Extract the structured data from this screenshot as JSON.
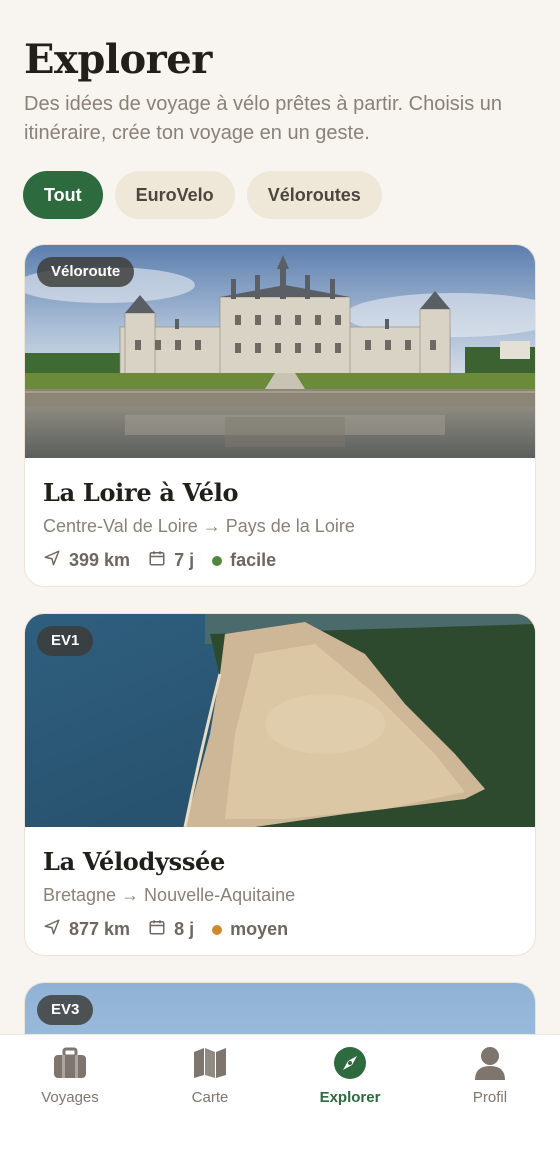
{
  "header": {
    "title": "Explorer",
    "subtitle": "Des idées de voyage à vélo prêtes à partir. Choisis un itinéraire, crée ton voyage en un geste."
  },
  "filters": [
    {
      "label": "Tout",
      "active": true
    },
    {
      "label": "EuroVelo",
      "active": false
    },
    {
      "label": "Véloroutes",
      "active": false
    }
  ],
  "routes": [
    {
      "badge": "Véloroute",
      "title": "La Loire à Vélo",
      "route": "Centre-Val de Loire → Pays de la Loire",
      "distance": "399 km",
      "duration": "7 j",
      "difficulty": "facile",
      "difficulty_color": "#4f8a3a",
      "image": "chateau-chambord-photo"
    },
    {
      "badge": "EV1",
      "title": "La Vélodyssée",
      "route": "Bretagne → Nouvelle-Aquitaine",
      "distance": "877 km",
      "duration": "8 j",
      "difficulty": "moyen",
      "difficulty_color": "#d08a2e",
      "image": "dune-du-pilat-photo"
    },
    {
      "badge": "EV3",
      "image": "sky-photo"
    }
  ],
  "tabs": [
    {
      "label": "Voyages",
      "icon": "briefcase-icon",
      "active": false
    },
    {
      "label": "Carte",
      "icon": "map-icon",
      "active": false
    },
    {
      "label": "Explorer",
      "icon": "compass-icon",
      "active": true
    },
    {
      "label": "Profil",
      "icon": "user-icon",
      "active": false
    }
  ],
  "colors": {
    "accent": "#2d6a3e",
    "background": "#f8f4ef",
    "chip_inactive": "#efe8d9"
  }
}
